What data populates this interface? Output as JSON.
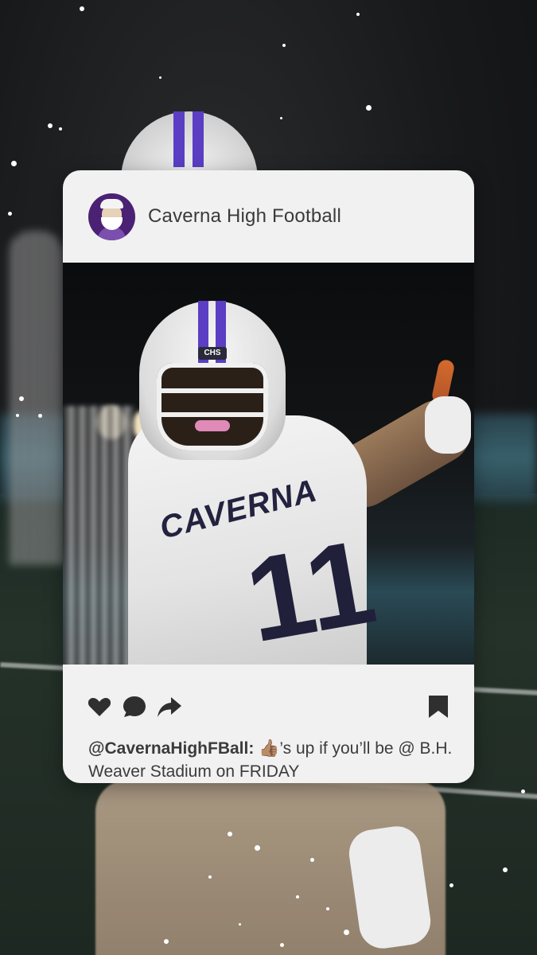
{
  "post": {
    "account_name": "Caverna High Football",
    "caption_handle": "@CavernaHighFBall:",
    "caption_emoji": "👍🏽",
    "caption_text": "’s up if you’ll be @ B.H. Weaver Stadium on FRIDAY"
  },
  "photo": {
    "helmet_badge": "CHS",
    "jersey_text": "CAVERNA",
    "jersey_number": "11"
  },
  "icons": {
    "like": "heart-icon",
    "comment": "comment-bubble-icon",
    "share": "share-arrow-icon",
    "save": "bookmark-icon"
  },
  "colors": {
    "card_bg": "#f1f1f1",
    "avatar_purple": "#4a2173",
    "helmet_stripe": "#5b3ec4",
    "icon_color": "#2f2f2f"
  }
}
